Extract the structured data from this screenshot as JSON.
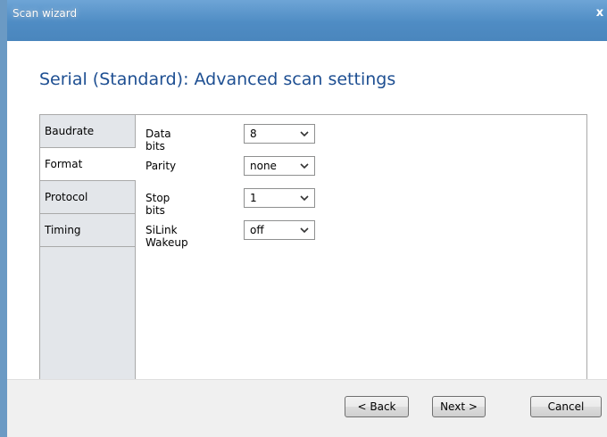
{
  "window": {
    "title": "Scan wizard",
    "close_glyph": "x"
  },
  "heading": "Serial (Standard): Advanced scan settings",
  "tabs": [
    {
      "label": "Baudrate",
      "selected": false
    },
    {
      "label": "Format",
      "selected": true
    },
    {
      "label": "Protocol",
      "selected": false
    },
    {
      "label": "Timing",
      "selected": false
    }
  ],
  "fields": [
    {
      "label": "Data bits",
      "value": "8"
    },
    {
      "label": "Parity",
      "value": "none"
    },
    {
      "label": "Stop bits",
      "value": "1"
    },
    {
      "label": "SiLink Wakeup",
      "value": "off"
    }
  ],
  "buttons": {
    "back": "< Back",
    "next": "Next >",
    "cancel": "Cancel"
  },
  "colors": {
    "titlebar": "#5a95cc",
    "heading": "#1e4f92",
    "tab_background": "#e3e6ea"
  }
}
